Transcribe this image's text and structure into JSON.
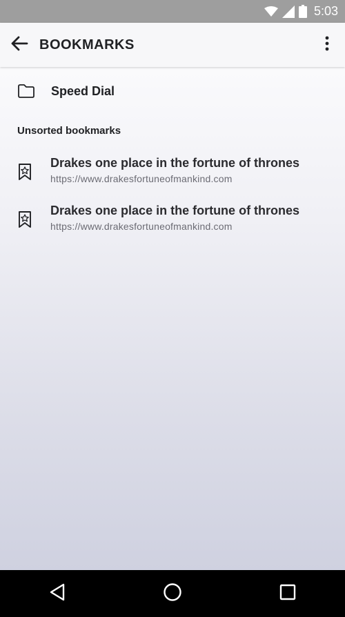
{
  "status_bar": {
    "time": "5:03",
    "icons": [
      "wifi-icon",
      "signal-icon",
      "battery-icon"
    ]
  },
  "app_bar": {
    "title": "BOOKMARKS",
    "back_icon": "back-arrow-icon",
    "menu_icon": "overflow-menu-icon"
  },
  "folders": [
    {
      "label": "Speed Dial",
      "icon": "folder-icon"
    }
  ],
  "section": {
    "title": "Unsorted bookmarks"
  },
  "bookmarks": [
    {
      "title": "Drakes one place in the fortune of thrones",
      "url": "https://www.drakesfortuneofmankind.com",
      "icon": "bookmark-star-icon"
    },
    {
      "title": "Drakes one place in the fortune of thrones",
      "url": "https://www.drakesfortuneofmankind.com",
      "icon": "bookmark-star-icon"
    }
  ],
  "nav_bar": {
    "icons": [
      "nav-back-icon",
      "nav-home-icon",
      "nav-recents-icon"
    ]
  },
  "colors": {
    "status_bar": "#9e9e9e",
    "app_bar": "#f7f7f9",
    "nav_bar": "#000000",
    "title_text": "#202124",
    "url_text": "#6b6b73"
  }
}
